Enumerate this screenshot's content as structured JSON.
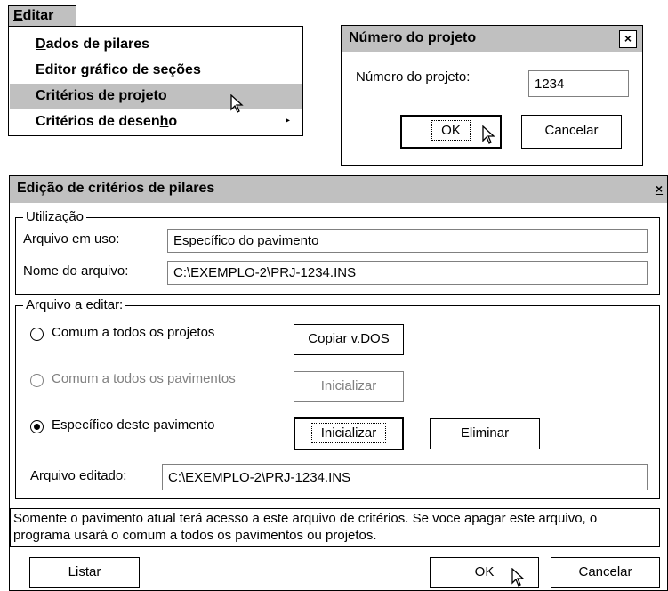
{
  "menu": {
    "title_underlined": "E",
    "title_rest": "ditar",
    "items": [
      {
        "pre": "",
        "u": "D",
        "post": "ados de pilares"
      },
      {
        "pre": "Editor ",
        "u": "g",
        "post": "ráfico de seções"
      },
      {
        "pre": "Cr",
        "u": "i",
        "post": "térios de projeto"
      },
      {
        "pre": "Critérios de desen",
        "u": "h",
        "post": "o"
      }
    ],
    "submenu_arrow": "▸"
  },
  "project_dialog": {
    "title": "Número do projeto",
    "close": "×",
    "label": "Número do projeto:",
    "value": "1234",
    "ok": "OK",
    "cancel": "Cancelar"
  },
  "criteria_dialog": {
    "title": "Edição de critérios de pilares",
    "close": "×",
    "usage": {
      "legend": "Utilização",
      "file_in_use_label": "Arquivo em uso:",
      "file_in_use_value": "Específico do pavimento",
      "file_name_label": "Nome do arquivo:",
      "file_name_value": "C:\\EXEMPLO-2\\PRJ-1234.INS"
    },
    "edit": {
      "legend": "Arquivo a editar:",
      "options": [
        {
          "label": "Comum a todos os projetos",
          "selected": false,
          "enabled": true
        },
        {
          "label": "Comum a todos os pavimentos",
          "selected": false,
          "enabled": false
        },
        {
          "label": "Específico deste pavimento",
          "selected": true,
          "enabled": true
        }
      ],
      "copy_dos": "Copiar v.DOS",
      "init_disabled": "Inicializar",
      "init": "Inicializar",
      "delete": "Eliminar",
      "edited_label": "Arquivo editado:",
      "edited_value": "C:\\EXEMPLO-2\\PRJ-1234.INS"
    },
    "info": "Somente o pavimento atual terá acesso a este arquivo de critérios. Se voce apagar este arquivo, o programa usará o comum a todos os pavimentos ou projetos.",
    "list": "Listar",
    "ok": "OK",
    "cancel": "Cancelar"
  }
}
